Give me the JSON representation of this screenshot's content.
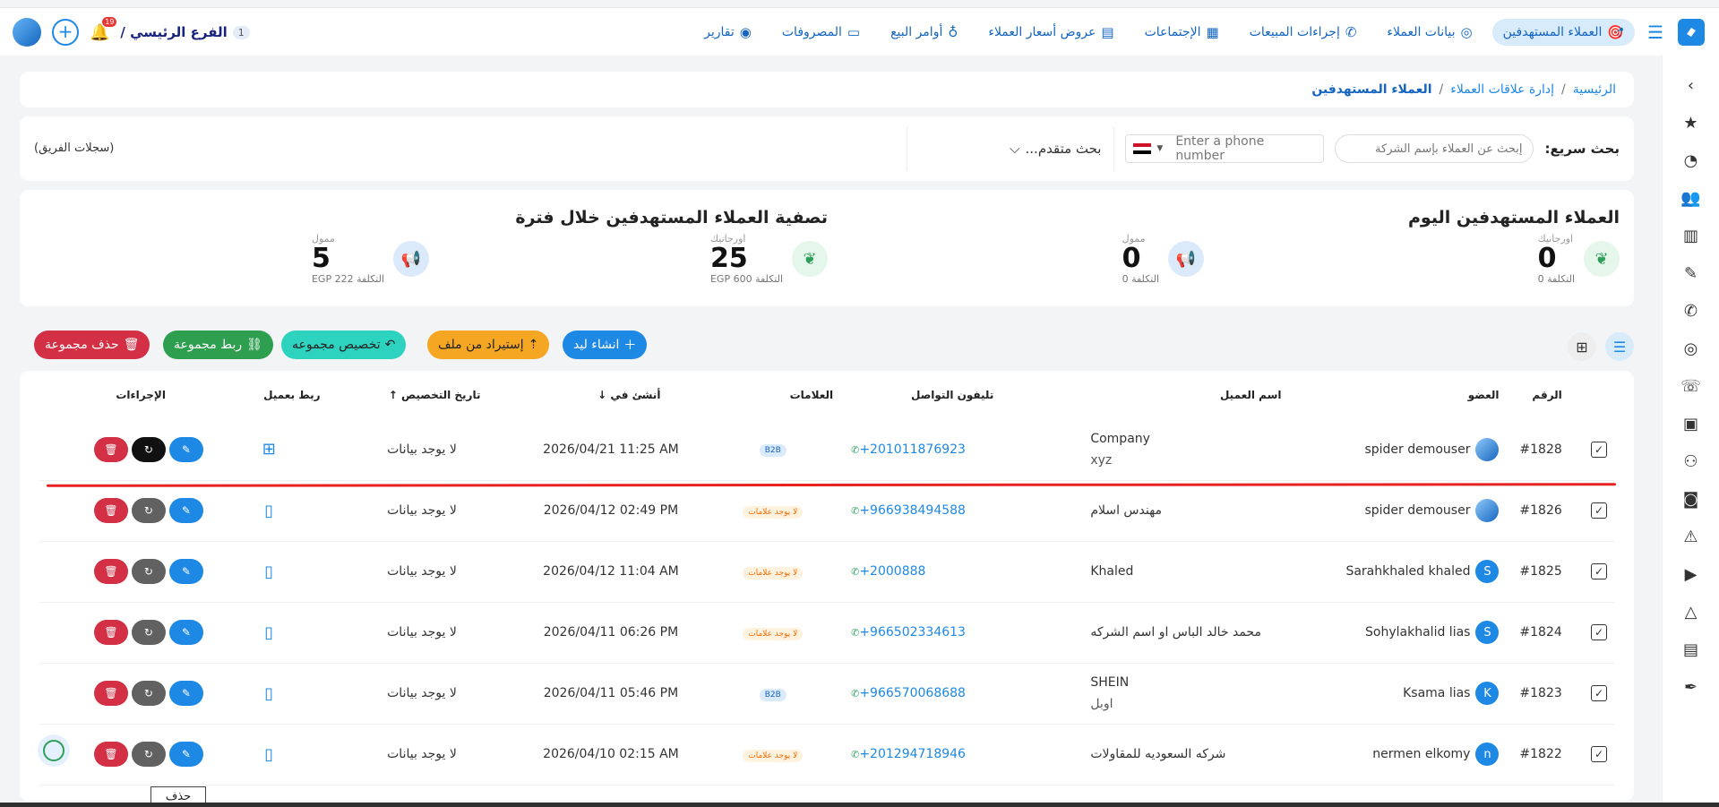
{
  "topbar": {
    "nav": [
      {
        "label": "العملاء المستهدفين",
        "icon": "🎯",
        "active": true
      },
      {
        "label": "بيانات العملاء",
        "icon": "◎"
      },
      {
        "label": "إجراءات المبيعات",
        "icon": "✆"
      },
      {
        "label": "الإجتماعات",
        "icon": "▦"
      },
      {
        "label": "عروض أسعار العملاء",
        "icon": "▤"
      },
      {
        "label": "أوامر البيع",
        "icon": "♁"
      },
      {
        "label": "المصروفات",
        "icon": "▭"
      },
      {
        "label": "تقارير",
        "icon": "◉"
      }
    ],
    "branch_label": "الفرع الرئيسي /",
    "branch_count": "1",
    "notification_count": "19"
  },
  "breadcrumb": {
    "home": "الرئيسية",
    "section": "إدارة علاقات العملاء",
    "current": "العملاء المستهدفين"
  },
  "search": {
    "label": "بحث سريع:",
    "company_placeholder": "إبحث عن العملاء بإسم الشركة",
    "phone_placeholder": "Enter a phone number",
    "advanced": "بحث متقدم...",
    "team_logs": "(سجلات الفريق)"
  },
  "stats": {
    "today_title": "العملاء المستهدفين اليوم",
    "period_title": "تصفية العملاء المستهدفين خلال فترة",
    "organic_label": "اورجانيك",
    "paid_label": "ممول",
    "cost_label": "التكلفة",
    "today_organic": "0",
    "today_organic_cost": "0",
    "today_paid": "0",
    "today_paid_cost": "0",
    "period_organic": "25",
    "period_organic_cost": "600 EGP",
    "period_paid": "5",
    "period_paid_cost": "222 EGP"
  },
  "actions": {
    "create_lead": "انشاء ليد",
    "import_file": "إستيراد من ملف",
    "assign_group": "تخصيص مجموعه",
    "link_group": "ربط مجموعة",
    "delete_group": "حذف مجموعة"
  },
  "table": {
    "headers": {
      "number": "الرقم",
      "member": "العضو",
      "client": "اسم العميل",
      "phone": "تليفون التواصل",
      "tags": "العلامات",
      "created": "أنشئ في",
      "assigned": "تاريخ التخصيص",
      "link_client": "ربط بعميل",
      "actions": "الإجراءات"
    },
    "rows": [
      {
        "number": "#1828",
        "member": "spider demouser",
        "client": "Company",
        "client_sub": "xyz",
        "phone": "+201011876923",
        "tag": "B2B",
        "created": "2026/04/21 11:25 AM",
        "assigned": "لا يوجد بيانات"
      },
      {
        "number": "#1826",
        "member": "spider demouser",
        "client": "مهندس اسلام",
        "client_sub": "",
        "phone": "+966938494588",
        "tag": "لا يوجد علامات",
        "created": "2026/04/12 02:49 PM",
        "assigned": "لا يوجد بيانات"
      },
      {
        "number": "#1825",
        "member": "Sarahkhaled khaled",
        "client": "Khaled",
        "client_sub": "",
        "phone": "+2000888",
        "tag": "لا يوجد علامات",
        "created": "2026/04/12 11:04 AM",
        "assigned": "لا يوجد بيانات"
      },
      {
        "number": "#1824",
        "member": "Sohylakhalid lias",
        "client": "محمد خالد الباس او اسم الشركه",
        "client_sub": "",
        "phone": "+966502334613",
        "tag": "لا يوجد علامات",
        "created": "2026/04/11 06:26 PM",
        "assigned": "لا يوجد بيانات"
      },
      {
        "number": "#1823",
        "member": "Ksama lias",
        "client": "SHEIN",
        "client_sub": "اوبل",
        "phone": "+966570068688",
        "tag": "B2B",
        "created": "2026/04/11 05:46 PM",
        "assigned": "لا يوجد بيانات"
      },
      {
        "number": "#1822",
        "member": "nermen elkomy",
        "client": "شركه السعوديه للمقاولات",
        "client_sub": "",
        "phone": "+201294718946",
        "tag": "لا يوجد علامات",
        "created": "2026/04/10 02:15 AM",
        "assigned": "لا يوجد بيانات"
      }
    ]
  },
  "avatars": [
    "logo",
    "logo",
    "S",
    "S",
    "K",
    "n"
  ],
  "tooltip": "حذف",
  "colors": {
    "primary": "#1e88e5",
    "create": "#1e88e5",
    "import": "#f5a623",
    "assign": "#2ed3c0",
    "link": "#2e9e4f",
    "delete": "#d32f45"
  }
}
